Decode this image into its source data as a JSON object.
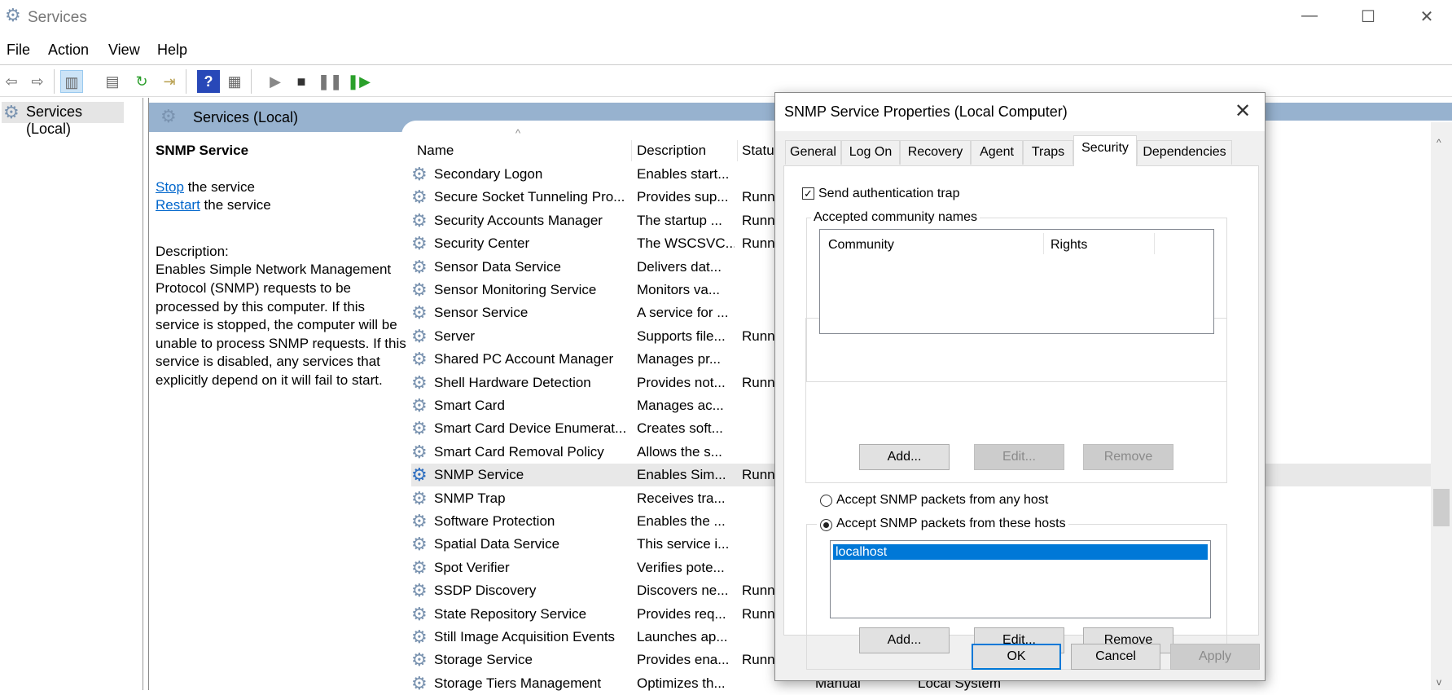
{
  "window": {
    "title": "Services",
    "minimize": "—",
    "maximize": "☐",
    "close": "✕"
  },
  "menu": [
    "File",
    "Action",
    "View",
    "Help"
  ],
  "toolbar": [
    "back-icon",
    "forward-icon",
    "show-hide-console-tree-icon",
    "properties-icon",
    "refresh-icon",
    "export-list-icon",
    "help-icon",
    "show-action-pane-icon",
    "start-service-icon",
    "stop-service-icon",
    "pause-service-icon",
    "resume-service-icon"
  ],
  "tree": {
    "root": "Services (Local)"
  },
  "main": {
    "band_title": "Services (Local)",
    "selected_service": "SNMP Service",
    "stop_link": "Stop",
    "stop_suffix": " the service",
    "restart_link": "Restart",
    "restart_suffix": " the service",
    "description_label": "Description:",
    "description": "Enables Simple Network Management Protocol (SNMP) requests to be processed by this computer. If this service is stopped, the computer will be unable to process SNMP requests. If this service is disabled, any services that explicitly depend on it will fail to start.",
    "columns": [
      "Name",
      "Description",
      "Status"
    ],
    "sort_indicator": "^",
    "rows": [
      {
        "name": "Secondary Logon",
        "desc": "Enables start...",
        "status": ""
      },
      {
        "name": "Secure Socket Tunneling Pro...",
        "desc": "Provides sup...",
        "status": "Running"
      },
      {
        "name": "Security Accounts Manager",
        "desc": "The startup ...",
        "status": "Running"
      },
      {
        "name": "Security Center",
        "desc": "The WSCSVC...",
        "status": "Running"
      },
      {
        "name": "Sensor Data Service",
        "desc": "Delivers dat...",
        "status": ""
      },
      {
        "name": "Sensor Monitoring Service",
        "desc": "Monitors va...",
        "status": ""
      },
      {
        "name": "Sensor Service",
        "desc": "A service for ...",
        "status": ""
      },
      {
        "name": "Server",
        "desc": "Supports file...",
        "status": "Running"
      },
      {
        "name": "Shared PC Account Manager",
        "desc": "Manages pr...",
        "status": ""
      },
      {
        "name": "Shell Hardware Detection",
        "desc": "Provides not...",
        "status": "Running"
      },
      {
        "name": "Smart Card",
        "desc": "Manages ac...",
        "status": ""
      },
      {
        "name": "Smart Card Device Enumerat...",
        "desc": "Creates soft...",
        "status": ""
      },
      {
        "name": "Smart Card Removal Policy",
        "desc": "Allows the s...",
        "status": ""
      },
      {
        "name": "SNMP Service",
        "desc": "Enables Sim...",
        "status": "Running",
        "selected": true
      },
      {
        "name": "SNMP Trap",
        "desc": "Receives tra...",
        "status": ""
      },
      {
        "name": "Software Protection",
        "desc": "Enables the ...",
        "status": ""
      },
      {
        "name": "Spatial Data Service",
        "desc": "This service i...",
        "status": ""
      },
      {
        "name": "Spot Verifier",
        "desc": "Verifies pote...",
        "status": ""
      },
      {
        "name": "SSDP Discovery",
        "desc": "Discovers ne...",
        "status": "Running"
      },
      {
        "name": "State Repository Service",
        "desc": "Provides req...",
        "status": "Running"
      },
      {
        "name": "Still Image Acquisition Events",
        "desc": "Launches ap...",
        "status": ""
      },
      {
        "name": "Storage Service",
        "desc": "Provides ena...",
        "status": "Running"
      },
      {
        "name": "Storage Tiers Management",
        "desc": "Optimizes th...",
        "status": "",
        "startup": "Manual",
        "logon": "Local System"
      }
    ]
  },
  "dialog": {
    "title": "SNMP Service Properties (Local Computer)",
    "close": "✕",
    "tabs": [
      "General",
      "Log On",
      "Recovery",
      "Agent",
      "Traps",
      "Security",
      "Dependencies"
    ],
    "active_tab": "Security",
    "send_auth_trap": {
      "label": "Send authentication trap",
      "checked": true
    },
    "community_group": "Accepted community names",
    "community_columns": [
      "Community",
      "Rights"
    ],
    "community_buttons": [
      "Add...",
      "Edit...",
      "Remove"
    ],
    "radio_any": {
      "label": "Accept SNMP packets from any host",
      "selected": false
    },
    "radio_these": {
      "label": "Accept SNMP packets from these hosts",
      "selected": true
    },
    "hosts": [
      "localhost"
    ],
    "host_buttons": [
      "Add...",
      "Edit...",
      "Remove"
    ],
    "ok": "OK",
    "cancel": "Cancel",
    "apply": "Apply"
  },
  "colors": {
    "band": "#97b2cf",
    "selection": "#0078d7",
    "link": "#0066cc"
  }
}
